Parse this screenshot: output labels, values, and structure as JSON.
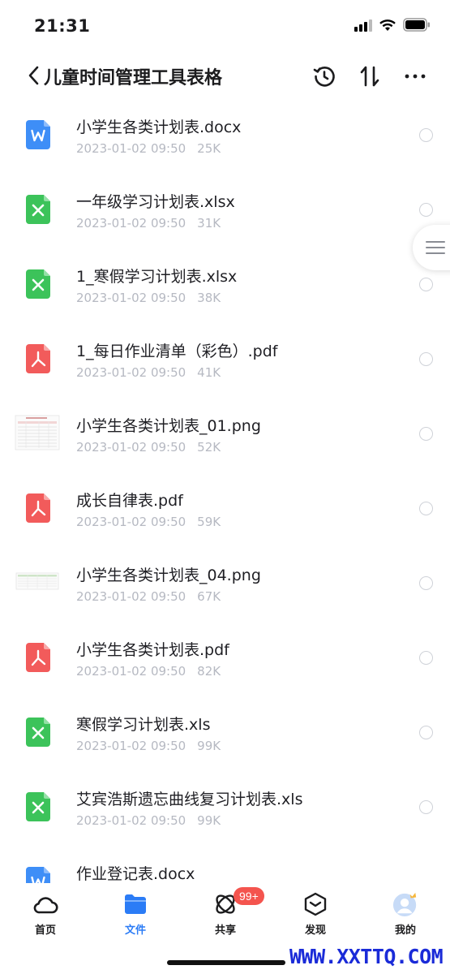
{
  "status": {
    "time": "21:31"
  },
  "header": {
    "title": "儿童时间管理工具表格"
  },
  "files": [
    {
      "name": "小学生各类计划表.docx",
      "date": "2023-01-02 09:50",
      "size": "25K",
      "type": "word"
    },
    {
      "name": "一年级学习计划表.xlsx",
      "date": "2023-01-02 09:50",
      "size": "31K",
      "type": "excel"
    },
    {
      "name": "1_寒假学习计划表.xlsx",
      "date": "2023-01-02 09:50",
      "size": "38K",
      "type": "excel"
    },
    {
      "name": "1_每日作业清单（彩色）.pdf",
      "date": "2023-01-02 09:50",
      "size": "41K",
      "type": "pdf"
    },
    {
      "name": "小学生各类计划表_01.png",
      "date": "2023-01-02 09:50",
      "size": "52K",
      "type": "image"
    },
    {
      "name": "成长自律表.pdf",
      "date": "2023-01-02 09:50",
      "size": "59K",
      "type": "pdf"
    },
    {
      "name": "小学生各类计划表_04.png",
      "date": "2023-01-02 09:50",
      "size": "67K",
      "type": "image"
    },
    {
      "name": "小学生各类计划表.pdf",
      "date": "2023-01-02 09:50",
      "size": "82K",
      "type": "pdf"
    },
    {
      "name": "寒假学习计划表.xls",
      "date": "2023-01-02 09:50",
      "size": "99K",
      "type": "excel"
    },
    {
      "name": "艾宾浩斯遗忘曲线复习计划表.xls",
      "date": "2023-01-02 09:50",
      "size": "99K",
      "type": "excel"
    },
    {
      "name": "作业登记表.docx",
      "date": "",
      "size": "",
      "type": "word"
    }
  ],
  "tabs": [
    {
      "label": "首页",
      "icon": "cloud-icon"
    },
    {
      "label": "文件",
      "icon": "folder-icon"
    },
    {
      "label": "共享",
      "icon": "orbit-icon"
    },
    {
      "label": "发现",
      "icon": "cube-icon"
    },
    {
      "label": "我的",
      "icon": "avatar-icon"
    }
  ],
  "share_badge": "99+",
  "watermark": "WWW.XXTTQ.COM",
  "colors": {
    "accent": "#2b7cf6",
    "word": "#3e8ef7",
    "excel": "#3cc35a",
    "pdf": "#f25b5b",
    "badge": "#f4544e"
  }
}
